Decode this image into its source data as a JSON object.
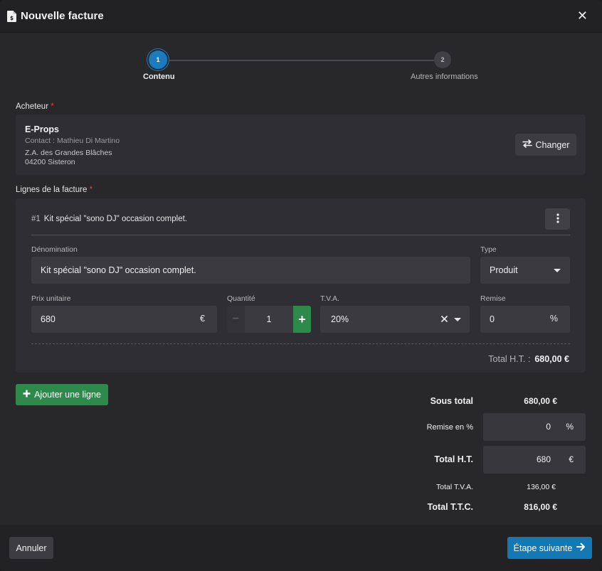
{
  "modal": {
    "title": "Nouvelle facture",
    "close_glyph": "✕"
  },
  "stepper": {
    "steps": [
      {
        "number": "1",
        "label": "Contenu",
        "active": true
      },
      {
        "number": "2",
        "label": "Autres informations",
        "active": false
      }
    ]
  },
  "buyer": {
    "label": "Acheteur",
    "required_mark": "*",
    "name": "E-Props",
    "contact": "Contact : Mathieu Di Martino",
    "address_line1": "Z.A. des Grandes Blâches",
    "address_line2": "04200 Sisteron",
    "change_button": "Changer"
  },
  "lines": {
    "label": "Lignes de la facture",
    "required_mark": "*",
    "items": [
      {
        "number": "#1",
        "title": "Kit spécial \"sono DJ\" occasion complet.",
        "denomination_label": "Dénomination",
        "denomination_value": "Kit spécial \"sono DJ\" occasion complet.",
        "type_label": "Type",
        "type_value": "Produit",
        "price_label": "Prix unitaire",
        "price_value": "680",
        "price_unit": "€",
        "qty_label": "Quantité",
        "qty_value": "1",
        "qty_minus": "−",
        "qty_plus": "+",
        "vat_label": "T.V.A.",
        "vat_value": "20%",
        "discount_label": "Remise",
        "discount_value": "0",
        "discount_unit": "%",
        "total_label": "Total H.T. :",
        "total_value": "680,00 €"
      }
    ],
    "add_button": "Ajouter une ligne"
  },
  "summary": {
    "subtotal_label": "Sous total",
    "subtotal_value": "680,00 €",
    "discount_label": "Remise en %",
    "discount_value": "0",
    "discount_unit": "%",
    "total_ht_label": "Total H.T.",
    "total_ht_value": "680",
    "total_ht_unit": "€",
    "total_tva_label": "Total T.V.A.",
    "total_tva_value": "136,00 €",
    "total_ttc_label": "Total T.T.C.",
    "total_ttc_value": "816,00 €"
  },
  "footer": {
    "cancel_button": "Annuler",
    "next_button": "Étape suivante"
  },
  "colors": {
    "primary": "#1478b5",
    "success": "#2e8a4b",
    "required": "#e0443a",
    "surface": "#28282b"
  }
}
